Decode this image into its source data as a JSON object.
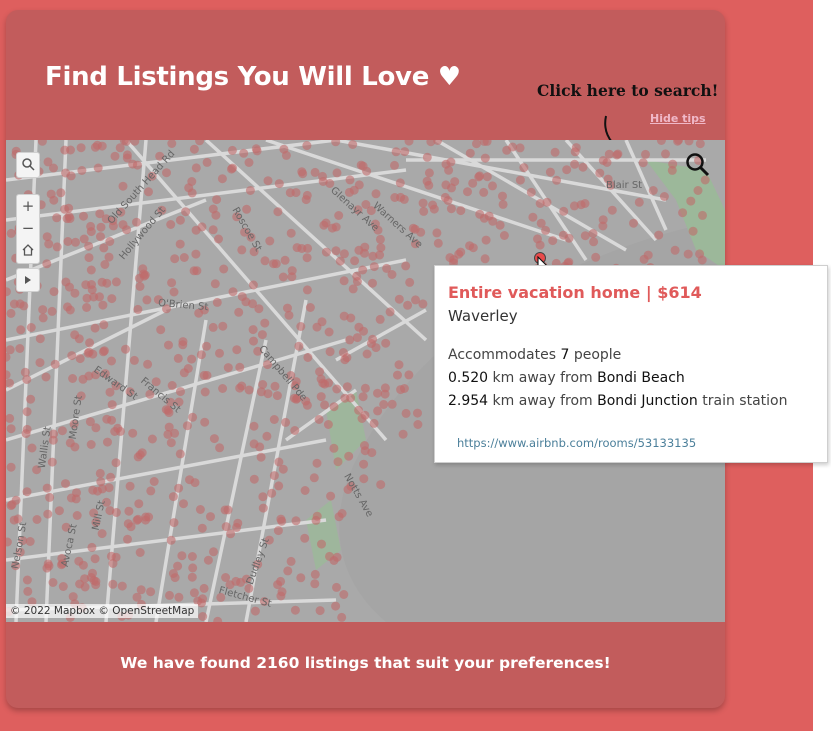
{
  "header": {
    "title": "Find Listings You Will Love ♥",
    "tip_text": "Click here to search!",
    "hide_tips_label": "Hide tips"
  },
  "map": {
    "attribution": "© 2022 Mapbox  © OpenStreetMap",
    "controls": {
      "search_icon": "magnifier-icon",
      "zoom_in_label": "+",
      "zoom_out_label": "−",
      "home_icon": "home-icon",
      "play_icon": "play-icon"
    },
    "search_button_icon": "magnifier-icon",
    "streets": [
      "Old South Head Rd",
      "Hollywood St",
      "O'Brien St",
      "Edward St",
      "Francis St",
      "Wallis St",
      "Moore St",
      "Avoca St",
      "Mill St",
      "Dudley St",
      "Fletcher St",
      "Blair St",
      "Notts Ave",
      "Nelson St",
      "Warners Ave",
      "Glenayr Ave",
      "Roscoe St",
      "Campbell Pde"
    ],
    "colors": {
      "land": "#a9a9a9",
      "roads": "#d9d9d9",
      "park": "#9cb89a",
      "dots": "#c06a6a",
      "marker": "#e84b4b"
    }
  },
  "tooltip": {
    "title": "Entire vacation home | $614",
    "suburb": "Waverley",
    "accommodates_prefix": "Accommodates",
    "accommodates_value": "7",
    "accommodates_suffix": "people",
    "beach_distance": "0.520",
    "beach_mid": "km away from",
    "beach_name": "Bondi Beach",
    "station_distance": "2.954",
    "station_mid": "km away from",
    "station_name": "Bondi Junction",
    "station_suffix": "train station",
    "link": "https://www.airbnb.com/rooms/53133135"
  },
  "footer": {
    "text": "We have found 2160 listings that suit your preferences!"
  },
  "colors": {
    "page_bg": "#de5f5e",
    "card_bg": "#c25c5c",
    "accent": "#e05a5a"
  }
}
